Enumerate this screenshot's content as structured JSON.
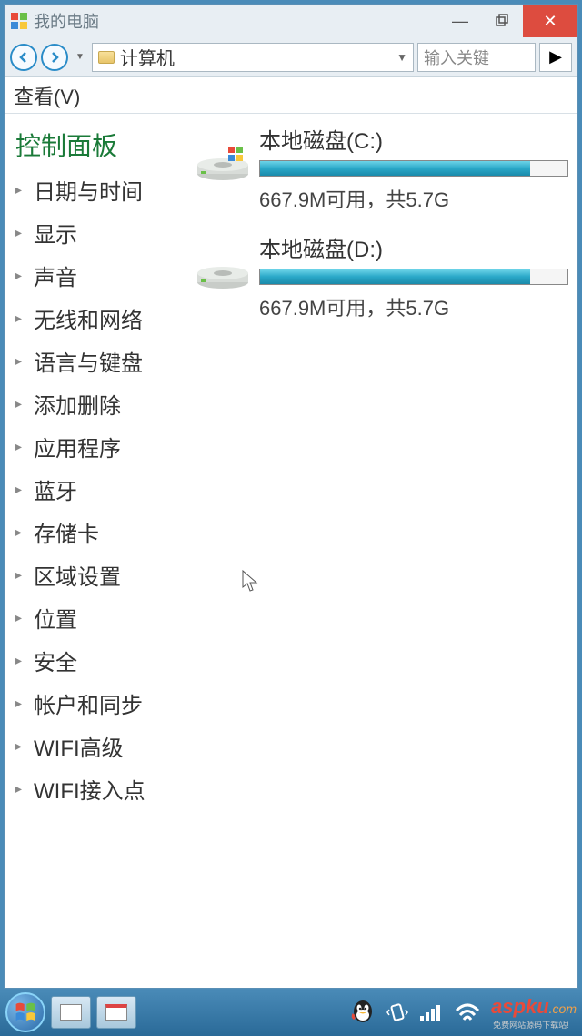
{
  "window": {
    "title": "我的电脑",
    "address": "计算机",
    "search_placeholder": "输入关键",
    "menu_view": "查看(V)"
  },
  "sidebar": {
    "title": "控制面板",
    "items": [
      {
        "label": "日期与时间"
      },
      {
        "label": "显示"
      },
      {
        "label": "声音"
      },
      {
        "label": "无线和网络"
      },
      {
        "label": "语言与键盘"
      },
      {
        "label": "添加删除"
      },
      {
        "label": "应用程序"
      },
      {
        "label": "蓝牙"
      },
      {
        "label": "存储卡"
      },
      {
        "label": "区域设置"
      },
      {
        "label": "位置"
      },
      {
        "label": "安全"
      },
      {
        "label": "帐户和同步"
      },
      {
        "label": "WIFI高级"
      },
      {
        "label": "WIFI接入点"
      }
    ]
  },
  "drives": [
    {
      "title": "本地磁盘(C:)",
      "info": "667.9M可用，共5.7G",
      "percent": 88,
      "hasLogo": true
    },
    {
      "title": "本地磁盘(D:)",
      "info": "667.9M可用，共5.7G",
      "percent": 88,
      "hasLogo": false
    }
  ],
  "watermark": {
    "main": "aspku",
    "sub": ".com",
    "small": "免费网站源码下载站!"
  }
}
